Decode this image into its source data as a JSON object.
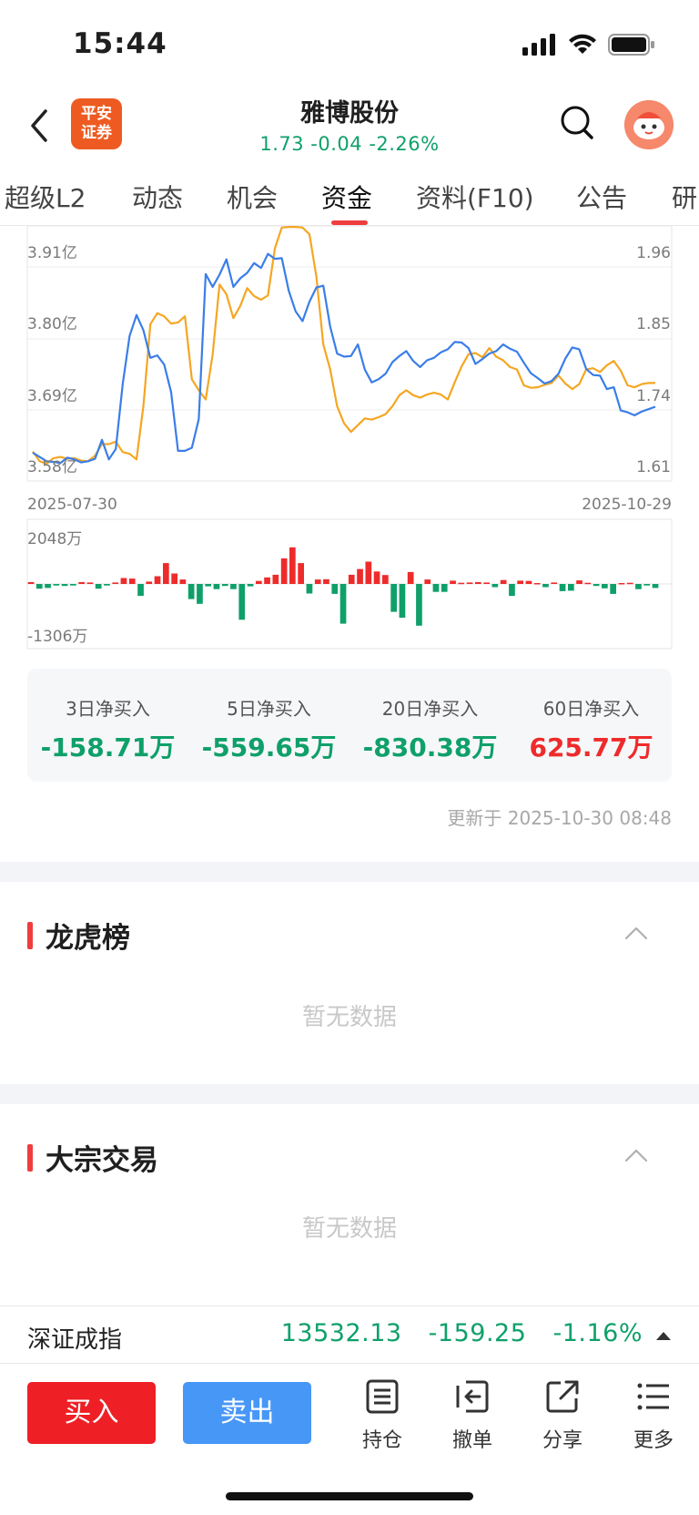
{
  "status_bar": {
    "time": "15:44"
  },
  "header": {
    "logo_text_line1": "平安",
    "logo_text_line2": "证券",
    "stock_name": "雅博股份",
    "quote": "1.73 -0.04 -2.26%",
    "quote_color": "#0fa06a"
  },
  "tabs": [
    {
      "label": "超级L2"
    },
    {
      "label": "动态"
    },
    {
      "label": "机会"
    },
    {
      "label": "资金",
      "active": true
    },
    {
      "label": "资料(F10)"
    },
    {
      "label": "公告"
    },
    {
      "label": "研"
    }
  ],
  "chart_data": [
    {
      "type": "line",
      "y_left_ticks": [
        "3.91亿",
        "3.80亿",
        "3.69亿",
        "3.58亿"
      ],
      "y_right_ticks": [
        "1.96",
        "1.85",
        "1.74",
        "1.61"
      ],
      "x_labels": [
        "2025-07-30",
        "2025-10-29"
      ],
      "ylim_right": [
        1.61,
        1.96
      ],
      "grid": true,
      "series": [
        {
          "color": "#f5a623",
          "values": [
            1.633,
            1.617,
            1.613,
            1.622,
            1.624,
            1.621,
            1.622,
            1.618,
            1.617,
            1.626,
            1.645,
            1.645,
            1.649,
            1.632,
            1.629,
            1.62,
            1.708,
            1.841,
            1.859,
            1.854,
            1.842,
            1.844,
            1.854,
            1.751,
            1.733,
            1.718,
            1.791,
            1.906,
            1.89,
            1.851,
            1.871,
            1.9,
            1.887,
            1.881,
            1.888,
            1.965,
            1.999,
            2.0,
            2.0,
            1.999,
            1.988,
            1.919,
            1.808,
            1.767,
            1.707,
            1.679,
            1.665,
            1.676,
            1.687,
            1.685,
            1.689,
            1.694,
            1.707,
            1.725,
            1.733,
            1.725,
            1.721,
            1.726,
            1.729,
            1.726,
            1.718,
            1.746,
            1.772,
            1.792,
            1.794,
            1.787,
            1.802,
            1.788,
            1.782,
            1.771,
            1.767,
            1.741,
            1.737,
            1.738,
            1.742,
            1.745,
            1.757,
            1.744,
            1.735,
            1.743,
            1.767,
            1.769,
            1.763,
            1.774,
            1.781,
            1.765,
            1.741,
            1.738,
            1.743,
            1.745,
            1.745
          ],
          "note_units": "right_axis"
        },
        {
          "color": "#3a7ee8",
          "values": [
            1.631,
            1.624,
            1.617,
            1.616,
            1.614,
            1.623,
            1.62,
            1.615,
            1.617,
            1.621,
            1.652,
            1.62,
            1.637,
            1.743,
            1.822,
            1.856,
            1.831,
            1.786,
            1.79,
            1.775,
            1.73,
            1.634,
            1.634,
            1.639,
            1.686,
            1.923,
            1.902,
            1.922,
            1.947,
            1.902,
            1.916,
            1.925,
            1.941,
            1.933,
            1.956,
            1.948,
            1.949,
            1.896,
            1.862,
            1.846,
            1.878,
            1.901,
            1.904,
            1.837,
            1.793,
            1.788,
            1.789,
            1.808,
            1.767,
            1.746,
            1.751,
            1.76,
            1.779,
            1.789,
            1.797,
            1.781,
            1.771,
            1.782,
            1.786,
            1.795,
            1.8,
            1.812,
            1.811,
            1.802,
            1.776,
            1.784,
            1.793,
            1.797,
            1.808,
            1.801,
            1.796,
            1.778,
            1.761,
            1.753,
            1.744,
            1.748,
            1.76,
            1.785,
            1.803,
            1.8,
            1.768,
            1.758,
            1.757,
            1.735,
            1.738,
            1.7,
            1.697,
            1.692,
            1.698,
            1.702,
            1.706
          ],
          "note_units": "right_axis"
        }
      ]
    },
    {
      "type": "bar",
      "y_ticks": [
        "2048万",
        "-1306万"
      ],
      "ylim": [
        -1306,
        2048
      ],
      "positive_color": "#ee2b2b",
      "negative_color": "#0fa06a",
      "values": [
        60,
        -120,
        -100,
        -40,
        -50,
        -40,
        60,
        50,
        -120,
        -40,
        50,
        200,
        180,
        -300,
        80,
        260,
        700,
        350,
        150,
        -380,
        -500,
        -60,
        -130,
        -50,
        -130,
        -900,
        -60,
        100,
        220,
        310,
        860,
        1230,
        700,
        -240,
        150,
        160,
        -250,
        -1000,
        310,
        500,
        750,
        420,
        300,
        -700,
        -850,
        400,
        -1050,
        150,
        -200,
        -200,
        110,
        40,
        50,
        60,
        50,
        -80,
        130,
        -300,
        110,
        100,
        30,
        -80,
        50,
        -180,
        -170,
        120,
        40,
        -50,
        -110,
        -250,
        30,
        40,
        -130,
        -40,
        -100
      ],
      "grid": true
    }
  ],
  "netbuy": [
    {
      "label": "3日净买入",
      "value": "-158.71万",
      "color": "#0fa06a"
    },
    {
      "label": "5日净买入",
      "value": "-559.65万",
      "color": "#0fa06a"
    },
    {
      "label": "20日净买入",
      "value": "-830.38万",
      "color": "#0fa06a"
    },
    {
      "label": "60日净买入",
      "value": "625.77万",
      "color": "#ee2b2b"
    }
  ],
  "update_time": "更新于 2025-10-30 08:48",
  "sections": [
    {
      "title": "龙虎榜",
      "empty_text": "暂无数据"
    },
    {
      "title": "大宗交易",
      "empty_text": "暂无数据"
    }
  ],
  "index_bar": {
    "name": "深证成指",
    "value": "13532.13",
    "change": "-159.25",
    "change_pct": "-1.16%"
  },
  "toolbar": {
    "buy_label": "买入",
    "sell_label": "卖出",
    "items": [
      {
        "label": "持仓",
        "icon": "holdings-icon"
      },
      {
        "label": "撤单",
        "icon": "cancel-order-icon"
      },
      {
        "label": "分享",
        "icon": "share-icon"
      },
      {
        "label": "更多",
        "icon": "more-icon"
      }
    ]
  }
}
